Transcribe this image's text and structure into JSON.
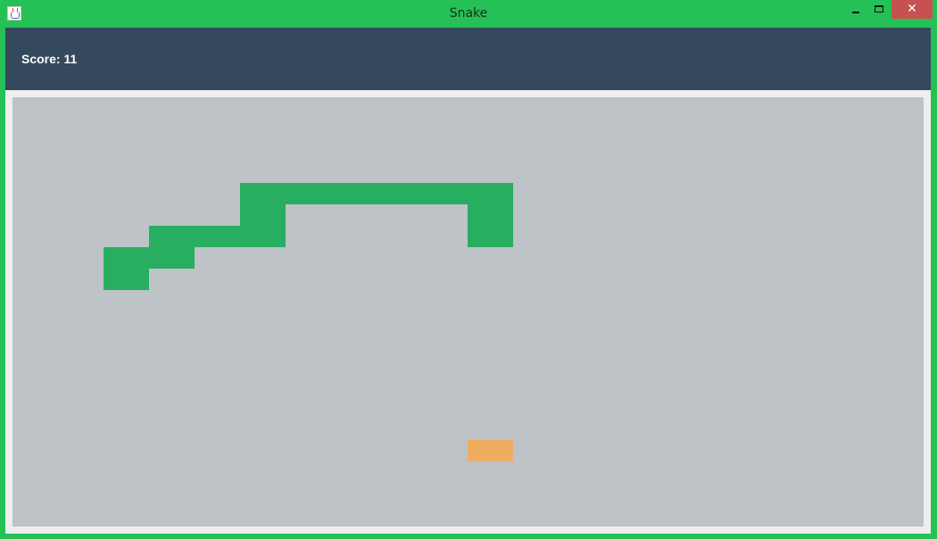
{
  "window": {
    "title": "Snake",
    "close_glyph": "✕",
    "colors": {
      "frame": "#25c156",
      "close_button": "#c75050"
    },
    "icons": [
      "java-app-icon",
      "minimize-icon",
      "maximize-icon",
      "close-icon"
    ]
  },
  "header": {
    "score_text": "Score: 11",
    "background": "#34495e"
  },
  "game": {
    "board_color": "#bdc3c7",
    "snake_color": "#27ae60",
    "food_color": "#f0ad60",
    "snake": [
      [
        5,
        4
      ],
      [
        6,
        4
      ],
      [
        7,
        4
      ],
      [
        8,
        4
      ],
      [
        9,
        4
      ],
      [
        10,
        4
      ],
      [
        5,
        5
      ],
      [
        10,
        5
      ],
      [
        3,
        6
      ],
      [
        4,
        6
      ],
      [
        5,
        6
      ],
      [
        10,
        6
      ],
      [
        2,
        7
      ],
      [
        3,
        7
      ],
      [
        2,
        8
      ]
    ],
    "food": [
      10,
      16
    ]
  }
}
